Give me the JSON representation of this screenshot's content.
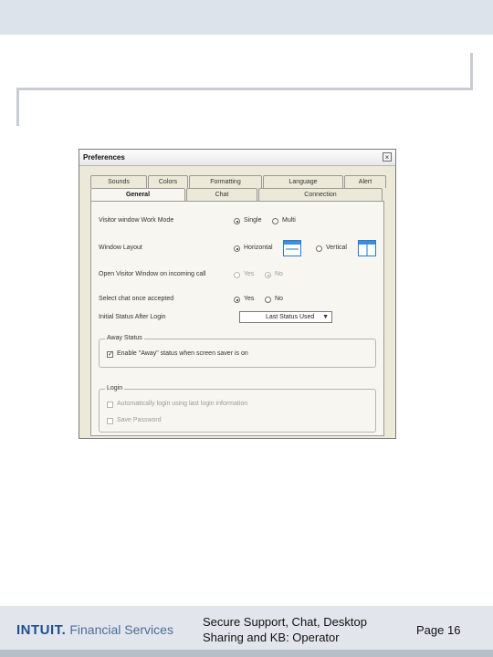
{
  "dialog": {
    "title": "Preferences",
    "close_symbol": "×",
    "tabs_row1": [
      "Sounds",
      "Colors",
      "Formatting",
      "Language",
      "Alert"
    ],
    "tabs_row2": [
      "General",
      "Chat",
      "Connection"
    ],
    "active_tab": "General"
  },
  "settings": {
    "work_mode": {
      "label": "Visitor window Work Mode",
      "options": [
        "Single",
        "Multi"
      ],
      "selected": "Single"
    },
    "layout": {
      "label": "Window Layout",
      "options": [
        "Horizontal",
        "Vertical"
      ],
      "selected": "Horizontal"
    },
    "open_window": {
      "label": "Open Visitor Window on incoming call",
      "options": [
        "Yes",
        "No"
      ],
      "selected": "No",
      "disabled": true
    },
    "select_chat": {
      "label": "Select chat once accepted",
      "options": [
        "Yes",
        "No"
      ],
      "selected": "Yes"
    },
    "status_after_login": {
      "label": "Initial Status After Login",
      "value": "Last Status Used"
    }
  },
  "away_group": {
    "legend": "Away Status",
    "checkbox_label": "Enable \"Away\" status when screen saver is on",
    "checked": true
  },
  "login_group": {
    "legend": "Login",
    "checkboxes": [
      "Automatically login using last login information",
      "Save Password"
    ]
  },
  "footer": {
    "brand": "INTUIT.",
    "brand_sub": "Financial Services",
    "title_line1": "Secure Support, Chat, Desktop",
    "title_line2": "Sharing and KB: Operator",
    "page": "Page 16"
  },
  "colors": {
    "accent": "#1d4f91",
    "dialog_bg": "#ece9d8"
  },
  "icons": [
    "close-icon",
    "horizontal-layout-icon",
    "vertical-layout-icon",
    "dropdown-arrow-icon",
    "checkmark-icon"
  ]
}
